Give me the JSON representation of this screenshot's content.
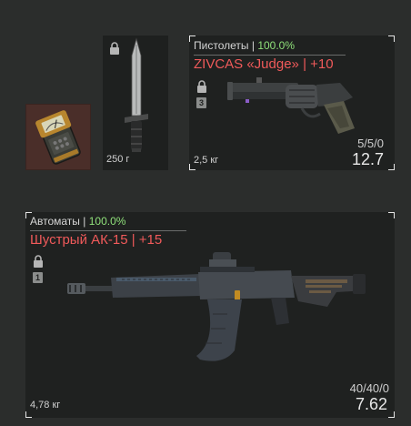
{
  "detector": {
    "icon": "anomaly-detector-icon"
  },
  "knife": {
    "icon": "knife-icon",
    "lock_icon": "lock-icon",
    "weight": "250 г"
  },
  "pistol": {
    "category": "Пистолеты",
    "separator": "|",
    "condition": "100.0%",
    "name": "ZIVCAS «Judge» | +10",
    "lock_icon": "lock-icon",
    "tier": "3",
    "icon": "revolver-icon",
    "weight": "2,5 кг",
    "ammo": "5/5/0",
    "damage": "12.7"
  },
  "rifle": {
    "category": "Автоматы",
    "separator": "|",
    "condition": "100.0%",
    "name": "Шустрый АК-15 | +15",
    "lock_icon": "lock-icon",
    "tier": "1",
    "icon": "assault-rifle-icon",
    "weight": "4,78 кг",
    "ammo": "40/40/0",
    "damage": "7.62"
  },
  "colors": {
    "condition": "#8fe07a",
    "item_name": "#f05a5a",
    "detector_bg": "#4a2e29"
  }
}
